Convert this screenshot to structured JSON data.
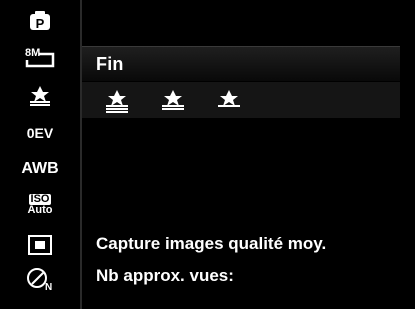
{
  "sidebar": {
    "items": [
      {
        "name": "program-mode",
        "icon": "P"
      },
      {
        "name": "image-size",
        "label": "8M"
      },
      {
        "name": "quality",
        "icon": "quality-icon"
      },
      {
        "name": "exposure",
        "label": "0EV"
      },
      {
        "name": "white-balance",
        "label": "AWB"
      },
      {
        "name": "iso",
        "label_top": "ISO",
        "label_bottom": "Auto"
      },
      {
        "name": "metering",
        "icon": "metering-icon"
      },
      {
        "name": "color",
        "icon": "color-icon"
      }
    ]
  },
  "menu": {
    "selected_label": "Fin",
    "options": [
      {
        "name": "fine",
        "icon": "quality-fine-icon"
      },
      {
        "name": "normal",
        "icon": "quality-normal-icon"
      },
      {
        "name": "economy",
        "icon": "quality-economy-icon"
      }
    ]
  },
  "description": {
    "line1": "Capture images qualité moy.",
    "line2": "Nb approx. vues:"
  },
  "colors": {
    "background": "#000000",
    "text": "#ffffff",
    "selection_gradient_top": "#1f1f1f",
    "selection_gradient_bottom": "#090909",
    "options_bg": "#151515",
    "divider": "#2a2a2a"
  }
}
